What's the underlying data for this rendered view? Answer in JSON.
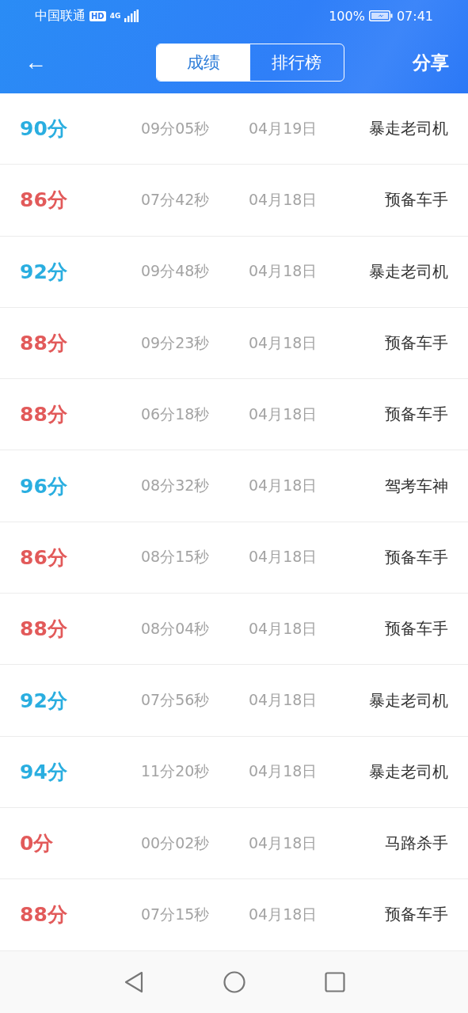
{
  "status_bar": {
    "carrier": "中国联通",
    "hd_badge": "HD",
    "network": "4G",
    "battery": "100%",
    "time": "07:41"
  },
  "header": {
    "back": "←",
    "tabs": [
      {
        "label": "成绩",
        "selected": true
      },
      {
        "label": "排行榜",
        "selected": false
      }
    ],
    "share": "分享"
  },
  "records": [
    {
      "score": "90分",
      "passed": true,
      "duration": "09分05秒",
      "date": "04月19日",
      "title": "暴走老司机"
    },
    {
      "score": "86分",
      "passed": false,
      "duration": "07分42秒",
      "date": "04月18日",
      "title": "预备车手"
    },
    {
      "score": "92分",
      "passed": true,
      "duration": "09分48秒",
      "date": "04月18日",
      "title": "暴走老司机"
    },
    {
      "score": "88分",
      "passed": false,
      "duration": "09分23秒",
      "date": "04月18日",
      "title": "预备车手"
    },
    {
      "score": "88分",
      "passed": false,
      "duration": "06分18秒",
      "date": "04月18日",
      "title": "预备车手"
    },
    {
      "score": "96分",
      "passed": true,
      "duration": "08分32秒",
      "date": "04月18日",
      "title": "驾考车神"
    },
    {
      "score": "86分",
      "passed": false,
      "duration": "08分15秒",
      "date": "04月18日",
      "title": "预备车手"
    },
    {
      "score": "88分",
      "passed": false,
      "duration": "08分04秒",
      "date": "04月18日",
      "title": "预备车手"
    },
    {
      "score": "92分",
      "passed": true,
      "duration": "07分56秒",
      "date": "04月18日",
      "title": "暴走老司机"
    },
    {
      "score": "94分",
      "passed": true,
      "duration": "11分20秒",
      "date": "04月18日",
      "title": "暴走老司机"
    },
    {
      "score": "0分",
      "passed": false,
      "duration": "00分02秒",
      "date": "04月18日",
      "title": "马路杀手"
    },
    {
      "score": "88分",
      "passed": false,
      "duration": "07分15秒",
      "date": "04月18日",
      "title": "预备车手"
    }
  ]
}
